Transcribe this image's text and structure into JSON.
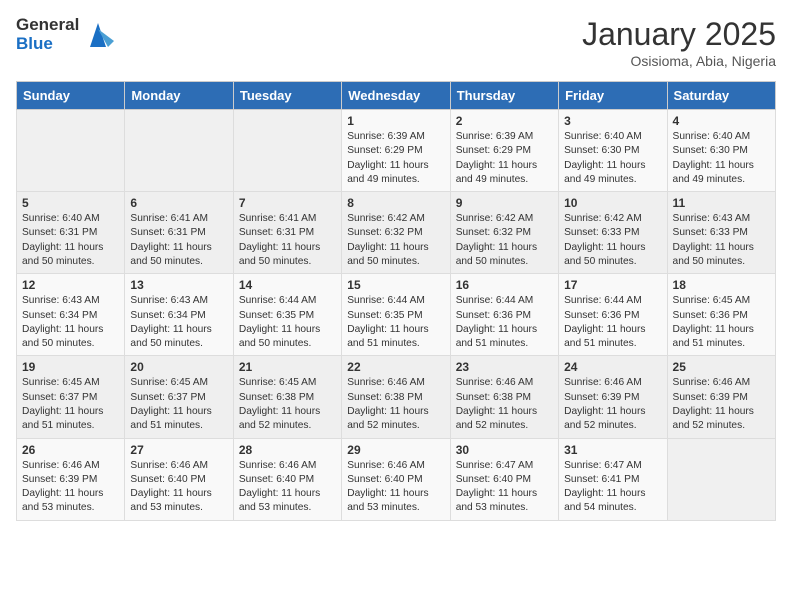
{
  "header": {
    "logo_general": "General",
    "logo_blue": "Blue",
    "month": "January 2025",
    "location": "Osisioma, Abia, Nigeria"
  },
  "days_of_week": [
    "Sunday",
    "Monday",
    "Tuesday",
    "Wednesday",
    "Thursday",
    "Friday",
    "Saturday"
  ],
  "weeks": [
    [
      {
        "day": "",
        "empty": true
      },
      {
        "day": "",
        "empty": true
      },
      {
        "day": "",
        "empty": true
      },
      {
        "day": "1",
        "sunrise": "6:39 AM",
        "sunset": "6:29 PM",
        "daylight": "11 hours and 49 minutes."
      },
      {
        "day": "2",
        "sunrise": "6:39 AM",
        "sunset": "6:29 PM",
        "daylight": "11 hours and 49 minutes."
      },
      {
        "day": "3",
        "sunrise": "6:40 AM",
        "sunset": "6:30 PM",
        "daylight": "11 hours and 49 minutes."
      },
      {
        "day": "4",
        "sunrise": "6:40 AM",
        "sunset": "6:30 PM",
        "daylight": "11 hours and 49 minutes."
      }
    ],
    [
      {
        "day": "5",
        "sunrise": "6:40 AM",
        "sunset": "6:31 PM",
        "daylight": "11 hours and 50 minutes."
      },
      {
        "day": "6",
        "sunrise": "6:41 AM",
        "sunset": "6:31 PM",
        "daylight": "11 hours and 50 minutes."
      },
      {
        "day": "7",
        "sunrise": "6:41 AM",
        "sunset": "6:31 PM",
        "daylight": "11 hours and 50 minutes."
      },
      {
        "day": "8",
        "sunrise": "6:42 AM",
        "sunset": "6:32 PM",
        "daylight": "11 hours and 50 minutes."
      },
      {
        "day": "9",
        "sunrise": "6:42 AM",
        "sunset": "6:32 PM",
        "daylight": "11 hours and 50 minutes."
      },
      {
        "day": "10",
        "sunrise": "6:42 AM",
        "sunset": "6:33 PM",
        "daylight": "11 hours and 50 minutes."
      },
      {
        "day": "11",
        "sunrise": "6:43 AM",
        "sunset": "6:33 PM",
        "daylight": "11 hours and 50 minutes."
      }
    ],
    [
      {
        "day": "12",
        "sunrise": "6:43 AM",
        "sunset": "6:34 PM",
        "daylight": "11 hours and 50 minutes."
      },
      {
        "day": "13",
        "sunrise": "6:43 AM",
        "sunset": "6:34 PM",
        "daylight": "11 hours and 50 minutes."
      },
      {
        "day": "14",
        "sunrise": "6:44 AM",
        "sunset": "6:35 PM",
        "daylight": "11 hours and 50 minutes."
      },
      {
        "day": "15",
        "sunrise": "6:44 AM",
        "sunset": "6:35 PM",
        "daylight": "11 hours and 51 minutes."
      },
      {
        "day": "16",
        "sunrise": "6:44 AM",
        "sunset": "6:36 PM",
        "daylight": "11 hours and 51 minutes."
      },
      {
        "day": "17",
        "sunrise": "6:44 AM",
        "sunset": "6:36 PM",
        "daylight": "11 hours and 51 minutes."
      },
      {
        "day": "18",
        "sunrise": "6:45 AM",
        "sunset": "6:36 PM",
        "daylight": "11 hours and 51 minutes."
      }
    ],
    [
      {
        "day": "19",
        "sunrise": "6:45 AM",
        "sunset": "6:37 PM",
        "daylight": "11 hours and 51 minutes."
      },
      {
        "day": "20",
        "sunrise": "6:45 AM",
        "sunset": "6:37 PM",
        "daylight": "11 hours and 51 minutes."
      },
      {
        "day": "21",
        "sunrise": "6:45 AM",
        "sunset": "6:38 PM",
        "daylight": "11 hours and 52 minutes."
      },
      {
        "day": "22",
        "sunrise": "6:46 AM",
        "sunset": "6:38 PM",
        "daylight": "11 hours and 52 minutes."
      },
      {
        "day": "23",
        "sunrise": "6:46 AM",
        "sunset": "6:38 PM",
        "daylight": "11 hours and 52 minutes."
      },
      {
        "day": "24",
        "sunrise": "6:46 AM",
        "sunset": "6:39 PM",
        "daylight": "11 hours and 52 minutes."
      },
      {
        "day": "25",
        "sunrise": "6:46 AM",
        "sunset": "6:39 PM",
        "daylight": "11 hours and 52 minutes."
      }
    ],
    [
      {
        "day": "26",
        "sunrise": "6:46 AM",
        "sunset": "6:39 PM",
        "daylight": "11 hours and 53 minutes."
      },
      {
        "day": "27",
        "sunrise": "6:46 AM",
        "sunset": "6:40 PM",
        "daylight": "11 hours and 53 minutes."
      },
      {
        "day": "28",
        "sunrise": "6:46 AM",
        "sunset": "6:40 PM",
        "daylight": "11 hours and 53 minutes."
      },
      {
        "day": "29",
        "sunrise": "6:46 AM",
        "sunset": "6:40 PM",
        "daylight": "11 hours and 53 minutes."
      },
      {
        "day": "30",
        "sunrise": "6:47 AM",
        "sunset": "6:40 PM",
        "daylight": "11 hours and 53 minutes."
      },
      {
        "day": "31",
        "sunrise": "6:47 AM",
        "sunset": "6:41 PM",
        "daylight": "11 hours and 54 minutes."
      },
      {
        "day": "",
        "empty": true
      }
    ]
  ]
}
